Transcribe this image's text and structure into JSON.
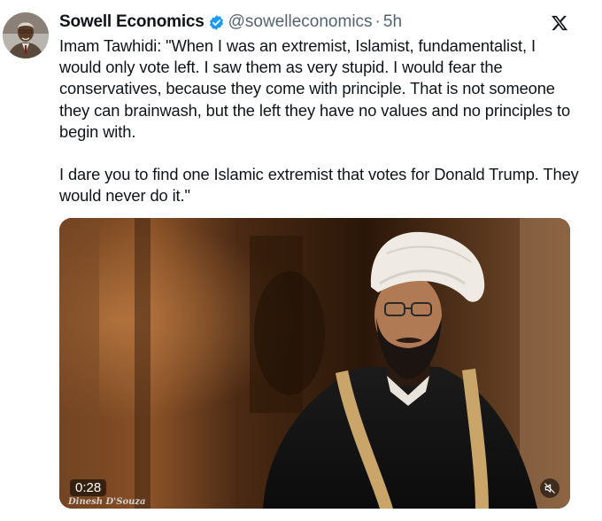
{
  "post": {
    "author_name": "Sowell Economics",
    "handle": "@sowelleconomics",
    "separator": "·",
    "time": "5h",
    "text": "Imam Tawhidi: \"When I was an extremist, Islamist, fundamentalist, I would only vote left. I saw them as very stupid. I would fear the conservatives, because they come with principle. That is not someone they can brainwash, but the left they have no values and no principles to begin with.\n\nI dare you to find one Islamic extremist that votes for Donald Trump. They would never do it.\""
  },
  "video": {
    "timecode": "0:28",
    "watermark": "Dinesh D'Souza"
  },
  "icons": {
    "verified": "verified-badge-icon",
    "platform_logo": "x-logo-icon",
    "mute": "mute-icon"
  },
  "colors": {
    "verified_blue": "#1d9bf0",
    "secondary_text": "#536471",
    "primary_text": "#0f1419"
  }
}
